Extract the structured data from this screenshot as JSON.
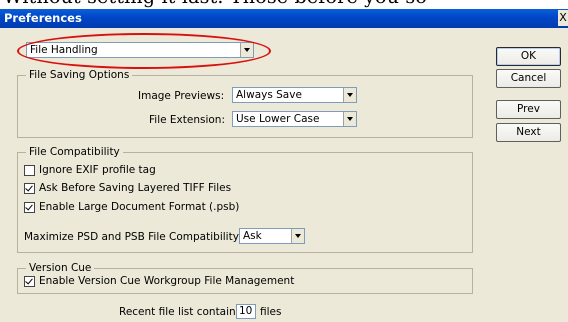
{
  "background_caption": "Without setting it last. Those before you so",
  "window": {
    "title": "Preferences",
    "close_glyph": "X"
  },
  "section_dropdown": {
    "selected": "File Handling"
  },
  "file_saving": {
    "legend": "File Saving Options",
    "image_previews_label": "Image Previews:",
    "image_previews_value": "Always Save",
    "file_extension_label": "File Extension:",
    "file_extension_value": "Use Lower Case"
  },
  "file_compat": {
    "legend": "File Compatibility",
    "checkboxes": [
      {
        "label": "Ignore EXIF profile tag",
        "checked": false
      },
      {
        "label": "Ask Before Saving Layered TIFF Files",
        "checked": true
      },
      {
        "label": "Enable Large Document Format (.psb)",
        "checked": true
      }
    ],
    "maximize_label": "Maximize PSD and PSB File Compatibility:",
    "maximize_value": "Ask"
  },
  "version_cue": {
    "legend": "Version Cue",
    "checkbox_label": "Enable Version Cue Workgroup File Management",
    "checked": true
  },
  "recent_files": {
    "label": "Recent file list contains:",
    "value": "10",
    "suffix": "files"
  },
  "buttons": {
    "ok": "OK",
    "cancel": "Cancel",
    "prev": "Prev",
    "next": "Next"
  },
  "colors": {
    "titlebar": "#0046c8",
    "dialog_bg": "#ece9d8",
    "highlight": "#d81010"
  }
}
